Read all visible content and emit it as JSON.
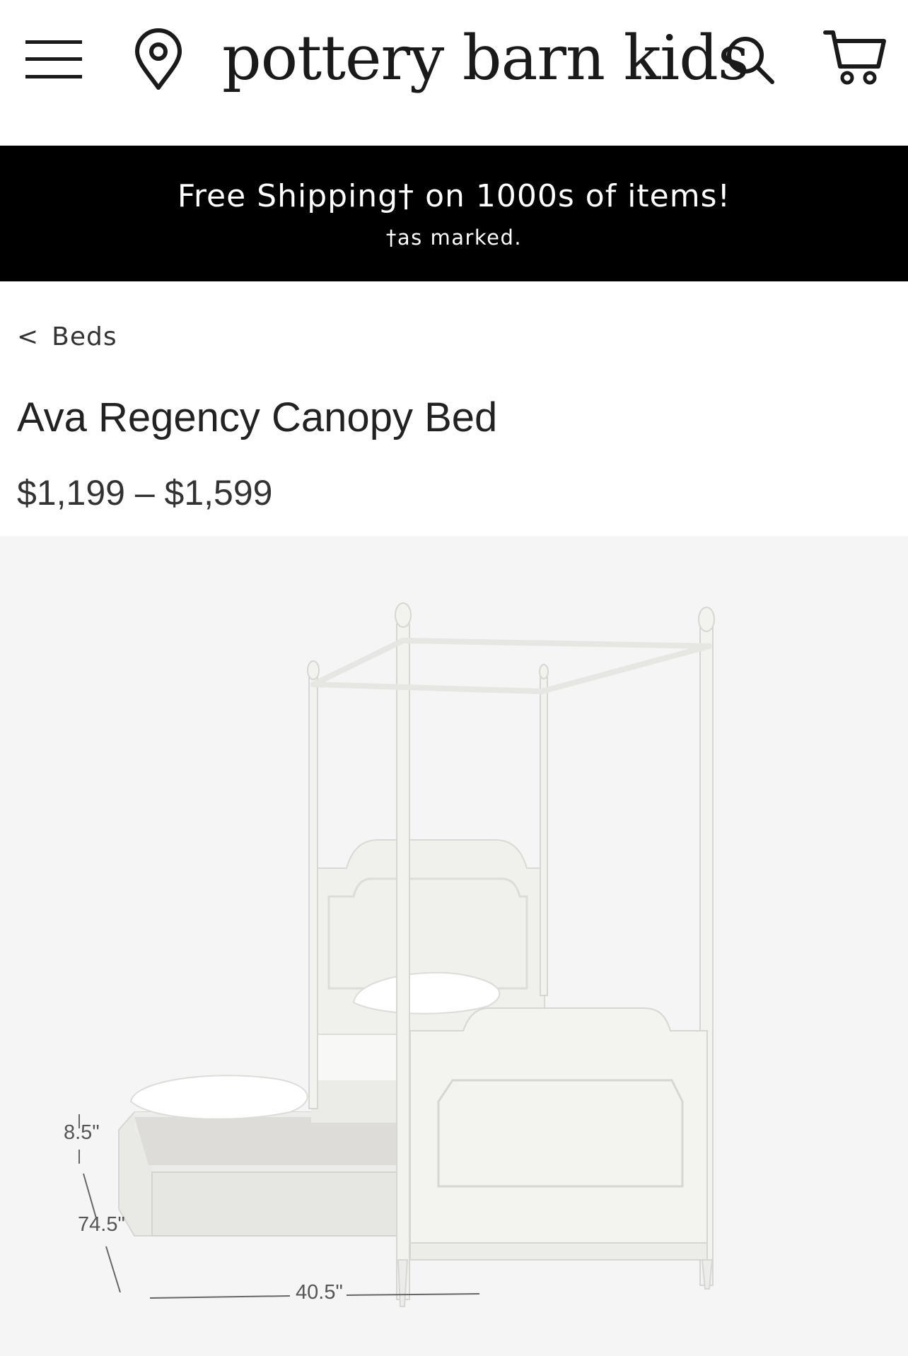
{
  "header": {
    "logo": "pottery barn kids",
    "icons": [
      "menu-icon",
      "location-icon",
      "search-icon",
      "cart-icon"
    ]
  },
  "promo": {
    "title": "Free Shipping† on 1000s of items!",
    "subtitle": "†as marked."
  },
  "breadcrumb": {
    "chevron": "<",
    "label": "Beds"
  },
  "product": {
    "title": "Ava Regency Canopy Bed",
    "price": "$1,199 – $1,599",
    "image": {
      "dimensions": {
        "height": "8.5\"",
        "length": "74.5\"",
        "width": "40.5\""
      }
    }
  },
  "colors": {
    "promo_bg": "#000000",
    "hero_bg": "#f5f5f5",
    "bed_white": "#efefec"
  }
}
